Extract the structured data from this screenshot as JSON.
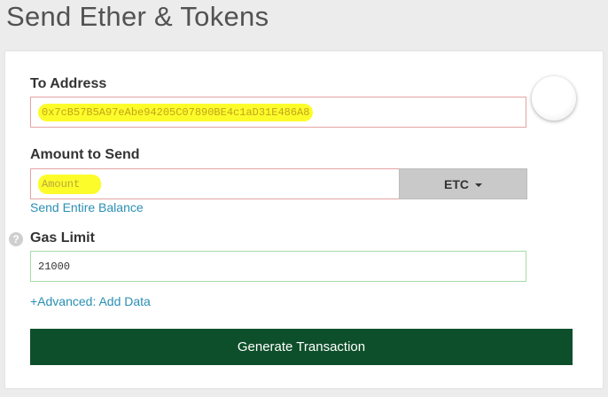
{
  "page": {
    "title": "Send Ether & Tokens"
  },
  "to_address": {
    "label": "To Address",
    "value": "0x7cB57B5A97eAbe94205C07890BE4c1aD31E486A8"
  },
  "amount": {
    "label": "Amount to Send",
    "placeholder": "Amount",
    "currency": "ETC",
    "send_entire_balance": "Send Entire Balance"
  },
  "gas": {
    "label": "Gas Limit",
    "help_glyph": "?",
    "value": "21000"
  },
  "advanced": {
    "label": "+Advanced: Add Data"
  },
  "actions": {
    "generate_label": "Generate Transaction"
  },
  "colors": {
    "primary_button": "#0d4f2a",
    "link": "#2a8fb3",
    "highlight": "#fcfc2a",
    "invalid_border": "#e4a3a3",
    "valid_border": "#a8dca8"
  }
}
